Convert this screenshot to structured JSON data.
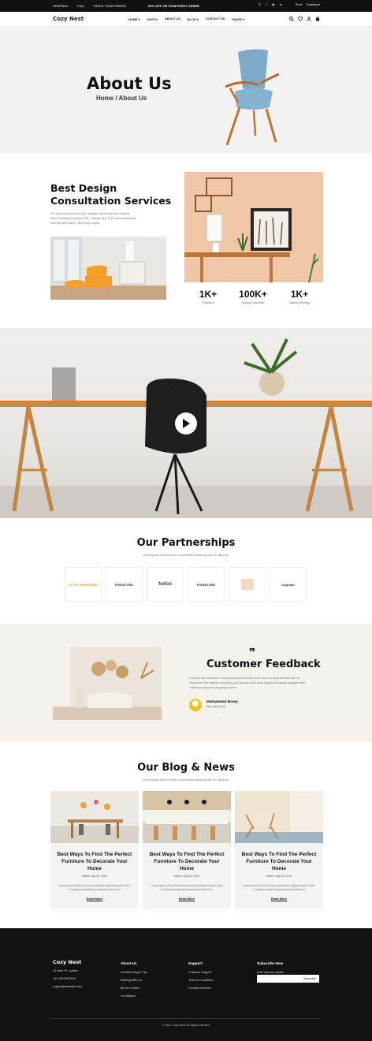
{
  "topbar": {
    "links": [
      "SHIPPING",
      "FAQ",
      "TRACK YOUR ORDER"
    ],
    "promo": "20% OFF ON YOUR FIRST ORDER",
    "language": "En",
    "country": "Country"
  },
  "nav": {
    "logo": "Cozy Nest",
    "menu": [
      "HOME",
      "SHOP",
      "ABOUT US",
      "BLOG",
      "CONTACT US",
      "PAGES"
    ]
  },
  "hero": {
    "title": "About Us",
    "breadcrumb": "Home / About Us"
  },
  "about": {
    "title_line1": "Best Design",
    "title_line2": "Consultation Services",
    "text": "You have to stay true to your heritage; that's what your brand is about. Dressing is a way of life. I always say. To be well dressed you must be well rested. I like things simple.",
    "stats": [
      {
        "value": "1K+",
        "label": "Furniture"
      },
      {
        "value": "100K+",
        "label": "Happy Customer"
      },
      {
        "value": "1K+",
        "label": "Award Winning"
      }
    ]
  },
  "partnerships": {
    "title": "Our Partnerships",
    "subtitle": "Lorem ipsum dolor sit amet, consectetur adipisicing elit. Ex, laborum.",
    "logos": [
      "STYLE FURNITURE",
      "FURNITURE",
      "fortisi",
      "FURNITURE",
      "",
      "elephant"
    ]
  },
  "feedback": {
    "title": "Customer Feedback",
    "text": "I recently had the pleasure of purchasing furniture from here, and I am beyond thrilled with my experience! The website is incredibly user-friendly, with a sleek design and intuitive navigation that makes browsing and shopping a breeze.",
    "name": "Mohammed Borey",
    "role": "Web Developer"
  },
  "blog": {
    "title": "Our Blog & News",
    "subtitle": "Lorem ipsum dolor sit amet, consectetur adipisicing elit. Ex, laborum.",
    "posts": [
      {
        "title": "Best Ways To Find The Perfect Furniture To Decorate Your Home",
        "meta": "Admin  July 23, 2024",
        "desc": "Lorem ipsum dolor sit amet consectetur adipisicing elit. Enim a veniam perspiciatis praesentium labore et",
        "more": "Read More"
      },
      {
        "title": "Best Ways To Find The Perfect Furniture To Decorate Your Home",
        "meta": "Admin  July 23, 2024",
        "desc": "Lorem ipsum dolor sit amet consectetur adipisicing elit. Enim a veniam perspiciatis praesentium labore et",
        "more": "Read More"
      },
      {
        "title": "Best Ways To Find The Perfect Furniture To Decorate Your Home",
        "meta": "Admin  July 23, 2024",
        "desc": "Lorem ipsum dolor sit amet consectetur adipisicing elit. Enim a veniam perspiciatis praesentium labore et",
        "more": "Read More"
      }
    ]
  },
  "footer": {
    "brand": "Cozy Nest",
    "address": "12 Main, Pt. London",
    "phone": "+44 1234 5678 90",
    "email": "support@example.com",
    "about_title": "About Us",
    "about_links": [
      "Furniture Blog & Tips",
      "Working With Us",
      "Be Our Partner",
      "Our Mission"
    ],
    "support_title": "Support",
    "support_links": [
      "Customer Support",
      "Terms & Conditions",
      "Contact Channels"
    ],
    "subscribe_title": "Subscribe Now",
    "subscribe_text": "Don't miss an update",
    "subscribe_button": "Subscribe",
    "copyright": "© 2024 Cozy Nest. All rights reserved."
  }
}
